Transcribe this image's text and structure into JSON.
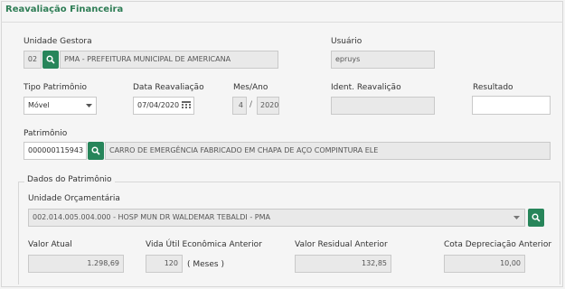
{
  "form": {
    "title": "Reavaliação Financeira",
    "unidade_gestora": {
      "label": "Unidade Gestora",
      "code": "02",
      "name": "PMA - PREFEITURA MUNICIPAL DE AMERICANA"
    },
    "usuario": {
      "label": "Usuário",
      "value": "epruys"
    },
    "tipo_patrimonio": {
      "label": "Tipo Patrimônio",
      "value": "Móvel"
    },
    "data_reavaliacao": {
      "label": "Data Reavaliação",
      "value": "07/04/2020"
    },
    "mes_ano": {
      "label": "Mes/Ano",
      "mes": "4",
      "separator": "/",
      "ano": "2020"
    },
    "ident_reavaliacao": {
      "label": "Ident. Reavalição",
      "value": ""
    },
    "resultado": {
      "label": "Resultado",
      "value": ""
    },
    "patrimonio": {
      "label": "Patrimônio",
      "code": "000000115943",
      "description": "CARRO DE EMERGÊNCIA FABRICADO EM CHAPA DE AÇO COMPINTURA ELE"
    }
  },
  "dados": {
    "legend": "Dados do Patrimônio",
    "unidade_orcamentaria": {
      "label": "Unidade Orçamentária",
      "value": "002.014.005.004.000 - HOSP MUN DR WALDEMAR TEBALDI - PMA"
    },
    "valor_atual": {
      "label": "Valor Atual",
      "value": "1.298,69"
    },
    "vida_util": {
      "label": "Vida Útil Econômica Anterior",
      "value": "120",
      "unit": "( Meses )"
    },
    "valor_residual": {
      "label": "Valor Residual Anterior",
      "value": "132,85"
    },
    "cota_depreciacao": {
      "label": "Cota Depreciação Anterior",
      "value": "10,00"
    }
  },
  "colors": {
    "accent": "#27855a",
    "title": "#2e7d55"
  },
  "icons": {
    "search": "search-icon",
    "calendar": "calendar-icon",
    "dropdown": "chevron-down-icon"
  }
}
